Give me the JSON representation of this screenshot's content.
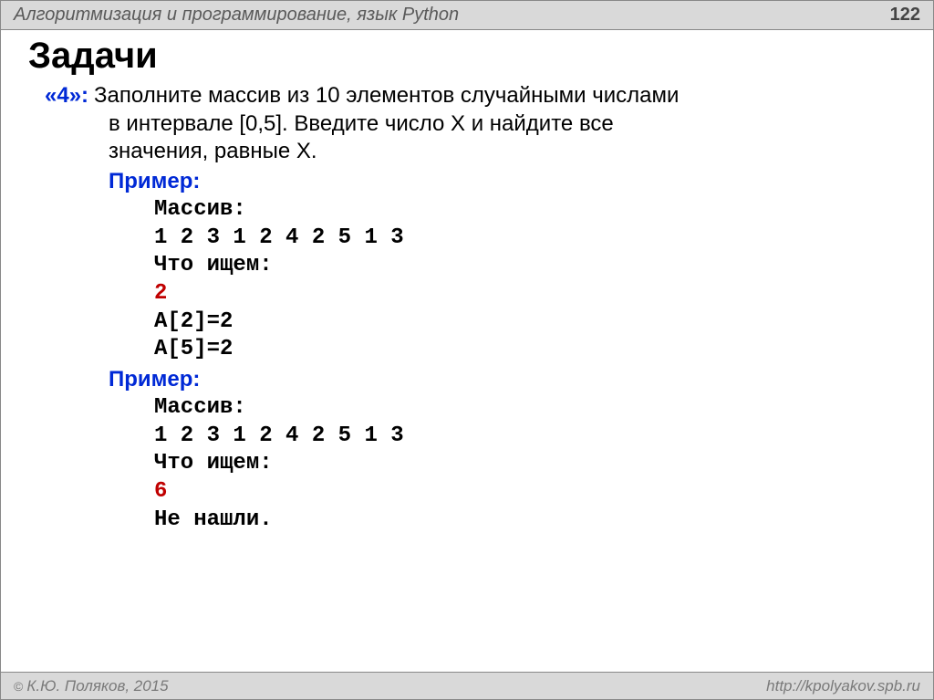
{
  "header": {
    "title": "Алгоритмизация и программирование, язык Python",
    "page": "122"
  },
  "title": "Задачи",
  "task": {
    "grade": "«4»:",
    "line1": "Заполните массив из 10 элементов случайными числами",
    "line2": "в интервале [0,5]. Введите число X и найдите все",
    "line3": "значения, равные X."
  },
  "exampleLabel": "Пример:",
  "ex1": {
    "l1": "Массив:",
    "l2": "1 2 3 1 2 4 2 5 1 3",
    "l3": "Что ищем:",
    "l4": "2",
    "l5": "A[2]=2",
    "l6": "A[5]=2"
  },
  "ex2": {
    "l1": "Массив:",
    "l2": "1 2 3 1 2 4 2 5 1 3",
    "l3": "Что ищем:",
    "l4": "6",
    "l5": "Не нашли."
  },
  "footer": {
    "copyright": "К.Ю. Поляков, 2015",
    "url": "http://kpolyakov.spb.ru"
  }
}
